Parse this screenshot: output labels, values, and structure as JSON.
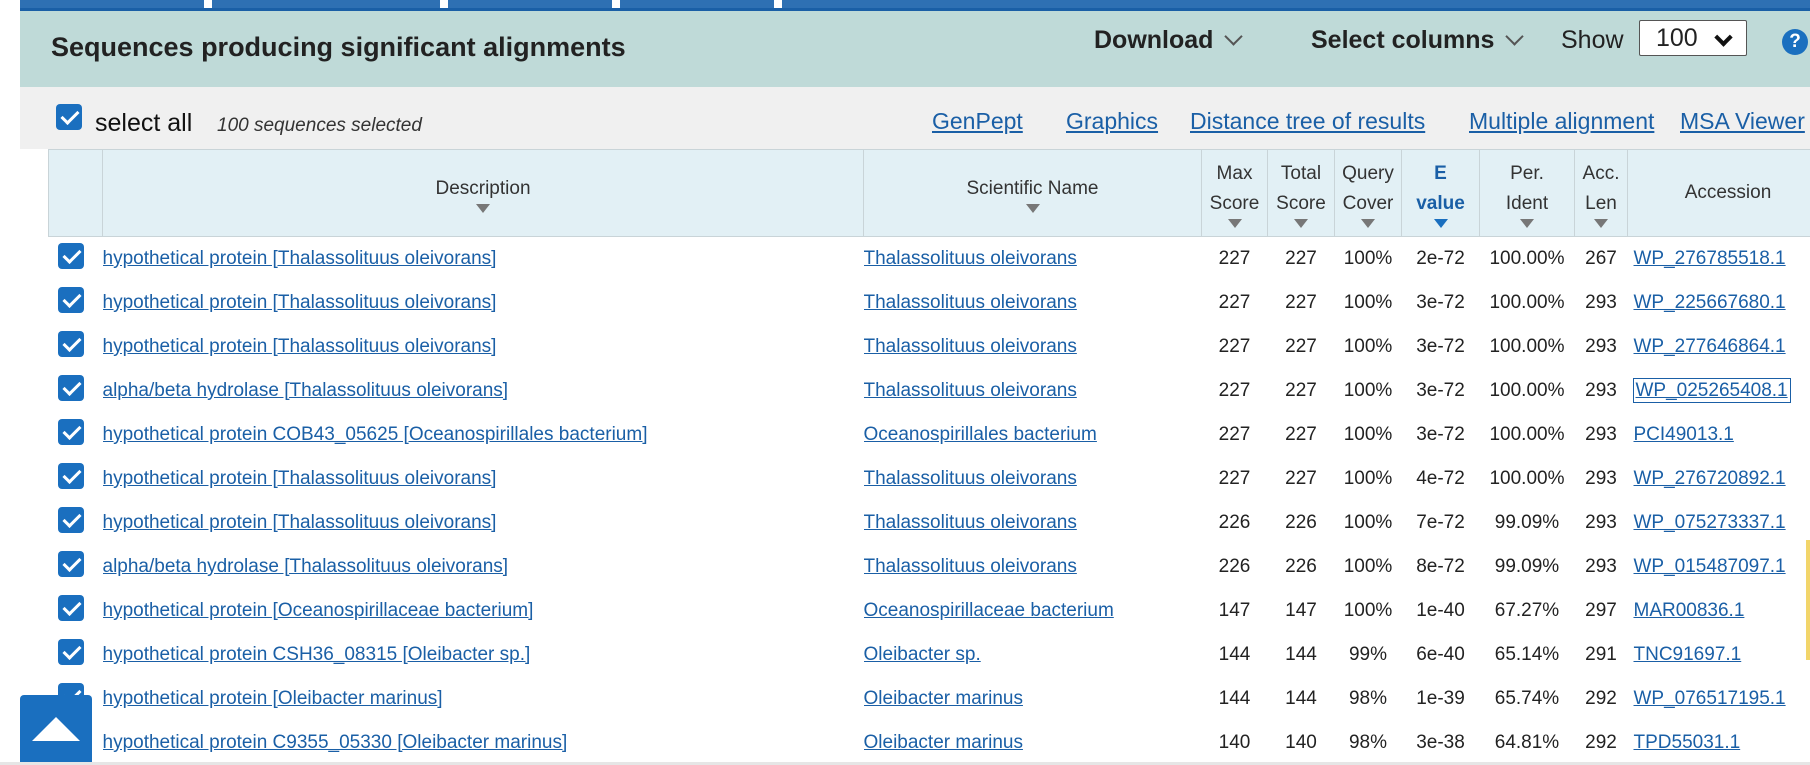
{
  "header": {
    "title": "Sequences producing significant alignments",
    "download_label": "Download",
    "select_columns_label": "Select columns",
    "show_label": "Show",
    "show_value": "100",
    "help_label": "?"
  },
  "toolbar": {
    "select_all_label": "select all",
    "selected_count": "100 sequences selected",
    "links": [
      "GenPept",
      "Graphics",
      "Distance tree of results",
      "Multiple alignment",
      "MSA Viewer"
    ]
  },
  "columns": {
    "description": "Description",
    "scientific_name": "Scientific Name",
    "max_score_1": "Max",
    "max_score_2": "Score",
    "total_score_1": "Total",
    "total_score_2": "Score",
    "query_cover_1": "Query",
    "query_cover_2": "Cover",
    "evalue_1": "E",
    "evalue_2": "value",
    "per_ident_1": "Per.",
    "per_ident_2": "Ident",
    "acc_len_1": "Acc.",
    "acc_len_2": "Len",
    "accession": "Accession"
  },
  "rows": [
    {
      "description": "hypothetical protein [Thalassolituus oleivorans]",
      "scientific_name": "Thalassolituus oleivorans",
      "max_score": "227",
      "total_score": "227",
      "query_cover": "100%",
      "evalue": "2e-72",
      "per_ident": "100.00%",
      "acc_len": "267",
      "accession": "WP_276785518.1"
    },
    {
      "description": "hypothetical protein [Thalassolituus oleivorans]",
      "scientific_name": "Thalassolituus oleivorans",
      "max_score": "227",
      "total_score": "227",
      "query_cover": "100%",
      "evalue": "3e-72",
      "per_ident": "100.00%",
      "acc_len": "293",
      "accession": "WP_225667680.1"
    },
    {
      "description": "hypothetical protein [Thalassolituus oleivorans]",
      "scientific_name": "Thalassolituus oleivorans",
      "max_score": "227",
      "total_score": "227",
      "query_cover": "100%",
      "evalue": "3e-72",
      "per_ident": "100.00%",
      "acc_len": "293",
      "accession": "WP_277646864.1"
    },
    {
      "description": "alpha/beta hydrolase [Thalassolituus oleivorans]",
      "scientific_name": "Thalassolituus oleivorans",
      "max_score": "227",
      "total_score": "227",
      "query_cover": "100%",
      "evalue": "3e-72",
      "per_ident": "100.00%",
      "acc_len": "293",
      "accession": "WP_025265408.1"
    },
    {
      "description": "hypothetical protein COB43_05625 [Oceanospirillales bacterium]",
      "scientific_name": "Oceanospirillales bacterium",
      "max_score": "227",
      "total_score": "227",
      "query_cover": "100%",
      "evalue": "3e-72",
      "per_ident": "100.00%",
      "acc_len": "293",
      "accession": "PCI49013.1"
    },
    {
      "description": "hypothetical protein [Thalassolituus oleivorans]",
      "scientific_name": "Thalassolituus oleivorans",
      "max_score": "227",
      "total_score": "227",
      "query_cover": "100%",
      "evalue": "4e-72",
      "per_ident": "100.00%",
      "acc_len": "293",
      "accession": "WP_276720892.1"
    },
    {
      "description": "hypothetical protein [Thalassolituus oleivorans]",
      "scientific_name": "Thalassolituus oleivorans",
      "max_score": "226",
      "total_score": "226",
      "query_cover": "100%",
      "evalue": "7e-72",
      "per_ident": "99.09%",
      "acc_len": "293",
      "accession": "WP_075273337.1"
    },
    {
      "description": "alpha/beta hydrolase [Thalassolituus oleivorans]",
      "scientific_name": "Thalassolituus oleivorans",
      "max_score": "226",
      "total_score": "226",
      "query_cover": "100%",
      "evalue": "8e-72",
      "per_ident": "99.09%",
      "acc_len": "293",
      "accession": "WP_015487097.1"
    },
    {
      "description": "hypothetical protein [Oceanospirillaceae bacterium]",
      "scientific_name": "Oceanospirillaceae bacterium",
      "max_score": "147",
      "total_score": "147",
      "query_cover": "100%",
      "evalue": "1e-40",
      "per_ident": "67.27%",
      "acc_len": "297",
      "accession": "MAR00836.1"
    },
    {
      "description": "hypothetical protein CSH36_08315 [Oleibacter sp.]",
      "scientific_name": "Oleibacter sp.",
      "max_score": "144",
      "total_score": "144",
      "query_cover": "99%",
      "evalue": "6e-40",
      "per_ident": "65.14%",
      "acc_len": "291",
      "accession": "TNC91697.1"
    },
    {
      "description": "hypothetical protein [Oleibacter marinus]",
      "scientific_name": "Oleibacter marinus",
      "max_score": "144",
      "total_score": "144",
      "query_cover": "98%",
      "evalue": "1e-39",
      "per_ident": "65.74%",
      "acc_len": "292",
      "accession": "WP_076517195.1"
    },
    {
      "description": "hypothetical protein C9355_05330 [Oleibacter marinus]",
      "scientific_name": "Oleibacter marinus",
      "max_score": "140",
      "total_score": "140",
      "query_cover": "98%",
      "evalue": "3e-38",
      "per_ident": "64.81%",
      "acc_len": "292",
      "accession": "TPD55031.1"
    }
  ],
  "colors": {
    "accent": "#1a6fbf",
    "link": "#1a5fa6",
    "header_bg": "#bfdad8",
    "table_header_bg": "#e2f0f5",
    "toolbar_bg": "#f0f0f0"
  },
  "icons": {
    "help": "question-circle-icon",
    "back_to_top": "arrow-up-icon",
    "dropdown": "chevron-down-icon",
    "sort": "sort-down-icon"
  }
}
